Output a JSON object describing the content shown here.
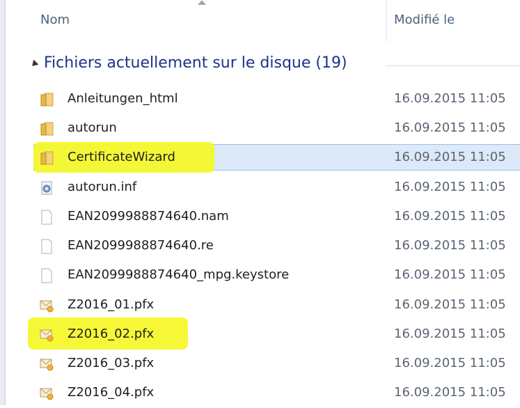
{
  "columns": {
    "name": "Nom",
    "date": "Modifié le"
  },
  "group": {
    "title": "Fichiers actuellement sur le disque (19)"
  },
  "files": [
    {
      "name": "Anleitungen_html",
      "date": "16.09.2015 11:05",
      "icon": "folder-icon"
    },
    {
      "name": "autorun",
      "date": "16.09.2015 11:05",
      "icon": "folder-icon"
    },
    {
      "name": "CertificateWizard",
      "date": "16.09.2015 11:05",
      "icon": "folder-icon"
    },
    {
      "name": "autorun.inf",
      "date": "16.09.2015 11:05",
      "icon": "settings-file-icon"
    },
    {
      "name": "EAN2099988874640.nam",
      "date": "16.09.2015 11:05",
      "icon": "blank-file-icon"
    },
    {
      "name": "EAN2099988874640.re",
      "date": "16.09.2015 11:05",
      "icon": "blank-file-icon"
    },
    {
      "name": "EAN2099988874640_mpg.keystore",
      "date": "16.09.2015 11:05",
      "icon": "blank-file-icon"
    },
    {
      "name": "Z2016_01.pfx",
      "date": "16.09.2015 11:05",
      "icon": "certificate-file-icon"
    },
    {
      "name": "Z2016_02.pfx",
      "date": "16.09.2015 11:05",
      "icon": "certificate-file-icon"
    },
    {
      "name": "Z2016_03.pfx",
      "date": "16.09.2015 11:05",
      "icon": "certificate-file-icon"
    },
    {
      "name": "Z2016_04.pfx",
      "date": "16.09.2015 11:05",
      "icon": "certificate-file-icon"
    }
  ],
  "colors": {
    "highlight": "#f5f82c",
    "selection": "#dbe9f8",
    "group_title": "#1e3287"
  }
}
